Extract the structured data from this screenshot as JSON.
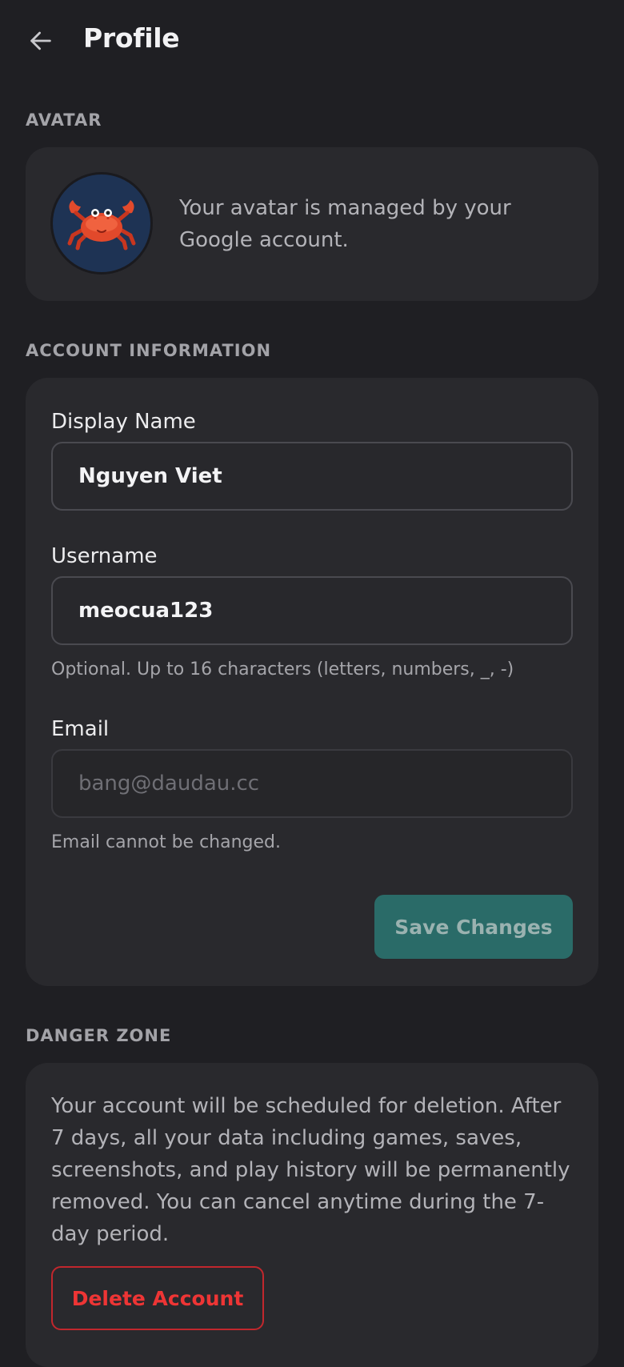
{
  "header": {
    "title": "Profile",
    "back_icon": "arrow-left-icon"
  },
  "avatar_section": {
    "label": "AVATAR",
    "description": "Your avatar is managed by your Google account.",
    "avatar_icon": "crab-icon"
  },
  "account_section": {
    "label": "ACCOUNT INFORMATION",
    "display_name": {
      "label": "Display Name",
      "value": "Nguyen Viet"
    },
    "username": {
      "label": "Username",
      "value": "meocua123",
      "hint": "Optional. Up to 16 characters (letters, numbers, _, -)"
    },
    "email": {
      "label": "Email",
      "value": "bang@daudau.cc",
      "hint": "Email cannot be changed."
    },
    "save_label": "Save Changes"
  },
  "danger_section": {
    "label": "DANGER ZONE",
    "description": "Your account will be scheduled for deletion. After 7 days, all your data including games, saves, screenshots, and play history will be permanently removed. You can cancel anytime during the 7-day period.",
    "delete_label": "Delete Account"
  },
  "colors": {
    "background": "#1f1f23",
    "card": "#29292d",
    "accent": "#2a6b68",
    "danger": "#ee3535"
  }
}
